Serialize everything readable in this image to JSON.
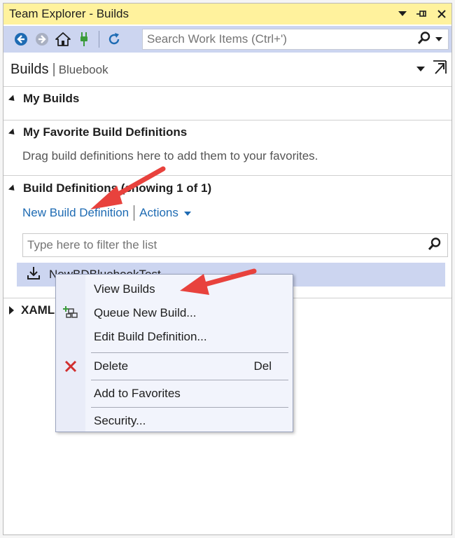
{
  "window": {
    "title": "Team Explorer - Builds",
    "colors": {
      "titlebar": "#fff29d",
      "toolbar": "#ccd5f0",
      "link": "#1e6bb3",
      "selection": "#ccd5f0",
      "annotation": "#e8423d"
    }
  },
  "titlebar_buttons": [
    {
      "icon": "dropdown-icon"
    },
    {
      "icon": "pin-icon"
    },
    {
      "icon": "close-icon"
    }
  ],
  "toolbar": {
    "icons": [
      "back-icon",
      "forward-icon",
      "home-icon",
      "connect-icon",
      "refresh-icon"
    ],
    "search_placeholder": "Search Work Items (Ctrl+')"
  },
  "header": {
    "title": "Builds",
    "divider": "|",
    "subtitle": "Bluebook"
  },
  "sections": {
    "my_builds": {
      "label": "My Builds"
    },
    "favorites": {
      "label": "My Favorite Build Definitions",
      "hint": "Drag build definitions here to add them to your favorites."
    },
    "definitions": {
      "label": "Build Definitions (showing 1 of 1)",
      "new_link": "New Build Definition",
      "actions_link": "Actions",
      "filter_placeholder": "Type here to filter the list",
      "item_name": "NewBDBluebookTest"
    },
    "xaml": {
      "label": "XAML"
    }
  },
  "context_menu": {
    "items": [
      {
        "label": "View Builds",
        "shortcut": "",
        "icon": ""
      },
      {
        "label": "Queue New Build...",
        "shortcut": "",
        "icon": "queue-build-icon"
      },
      {
        "label": "Edit Build Definition...",
        "shortcut": "",
        "icon": ""
      },
      {
        "label": "Delete",
        "shortcut": "Del",
        "icon": "delete-icon"
      },
      {
        "label": "Add to Favorites",
        "shortcut": "",
        "icon": ""
      },
      {
        "label": "Security...",
        "shortcut": "",
        "icon": ""
      }
    ]
  }
}
